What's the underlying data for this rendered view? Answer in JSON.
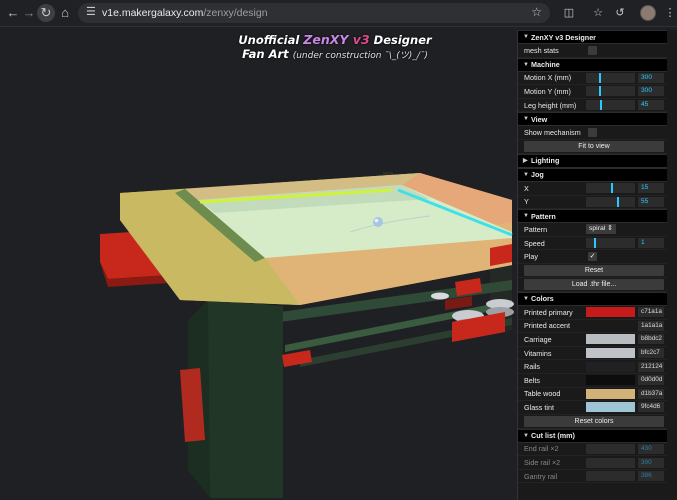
{
  "browser": {
    "url_host": "v1e.makergalaxy.com",
    "url_path": "/zenxy/design"
  },
  "title": {
    "prefix": "Unofficial ",
    "brand": "ZenXY",
    "version": " v3",
    "suffix": " Designer",
    "line2": "Fan Art",
    "line2_note": "(under construction ¯\\_(ツ)_/¯)"
  },
  "panel": {
    "root_folder": "ZenXY v3 Designer",
    "mesh_stats_label": "mesh stats",
    "machine": {
      "header": "Machine",
      "motion_x_label": "Motion X (mm)",
      "motion_x_value": "300",
      "motion_x_fill": 0.3,
      "motion_y_label": "Motion Y (mm)",
      "motion_y_value": "300",
      "motion_y_fill": 0.3,
      "leg_label": "Leg height (mm)",
      "leg_value": "45",
      "leg_fill": 0.33
    },
    "view": {
      "header": "View",
      "show_mechanism_label": "Show mechanism",
      "fit_button": "Fit to view"
    },
    "lighting": {
      "header": "Lighting"
    },
    "jog": {
      "header": "Jog",
      "x_label": "X",
      "x_value": "15",
      "x_fill": 0.55,
      "y_label": "Y",
      "y_value": "55",
      "y_fill": 0.68
    },
    "pattern": {
      "header": "Pattern",
      "pattern_label": "Pattern",
      "pattern_value": "spiral ⇕",
      "speed_label": "Speed",
      "speed_value": "1",
      "speed_fill": 0.2,
      "play_label": "Play",
      "play_checked": "✓",
      "reset_button": "Reset",
      "load_button": "Load .thr file..."
    },
    "colors": {
      "header": "Colors",
      "items": [
        {
          "label": "Printed primary",
          "hex": "c71a1a",
          "color": "#c71a1a"
        },
        {
          "label": "Printed accent",
          "hex": "1a1a1a",
          "color": "#1a1a1a"
        },
        {
          "label": "Carriage",
          "hex": "b8bdc2",
          "color": "#b8bdc2"
        },
        {
          "label": "Vitamins",
          "hex": "bfc2c7",
          "color": "#bfc2c7"
        },
        {
          "label": "Rails",
          "hex": "212124",
          "color": "#212124"
        },
        {
          "label": "Belts",
          "hex": "0d0d0d",
          "color": "#0d0d0d"
        },
        {
          "label": "Table wood",
          "hex": "d1b37a",
          "color": "#d1b37a"
        },
        {
          "label": "Glass tint",
          "hex": "9fc4d6",
          "color": "#9fc4d6"
        }
      ],
      "reset_button": "Reset colors"
    },
    "cutlist": {
      "header": "Cut list (mm)",
      "items": [
        {
          "label": "End rail ×2",
          "value": "430"
        },
        {
          "label": "Side rail ×2",
          "value": "390"
        },
        {
          "label": "Gantry rail",
          "value": "386"
        }
      ]
    }
  }
}
